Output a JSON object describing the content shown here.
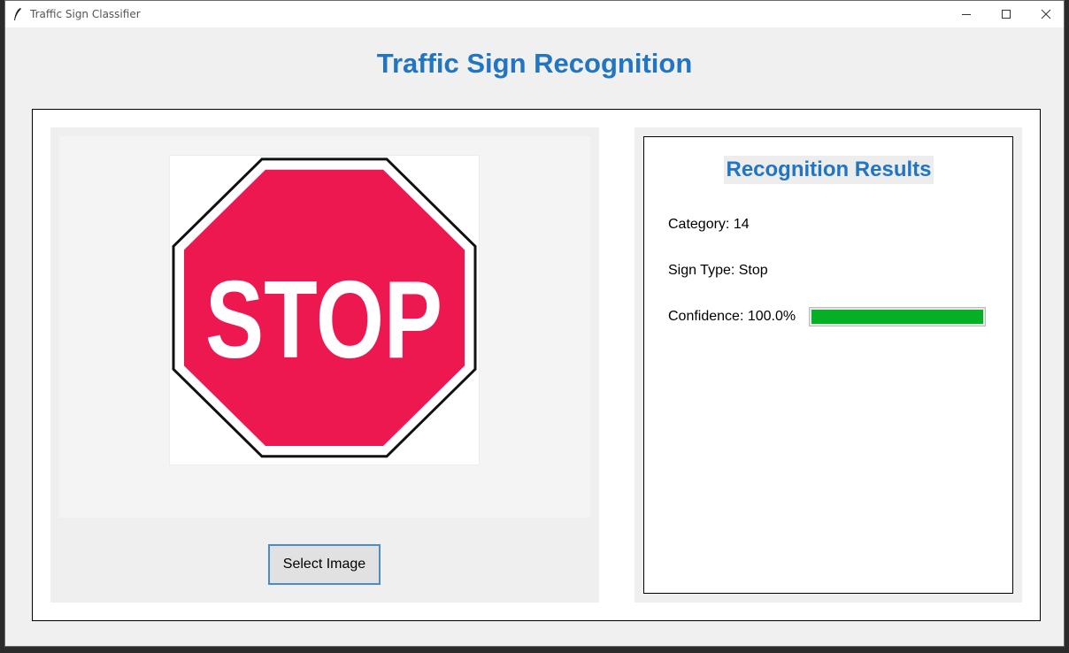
{
  "window": {
    "title": "Traffic Sign Classifier"
  },
  "header": {
    "title": "Traffic Sign Recognition"
  },
  "image_panel": {
    "image_icon": "stop-sign-icon",
    "image_text": "STOP",
    "select_button_label": "Select Image"
  },
  "results": {
    "title": "Recognition Results",
    "category_text": "Category: 14",
    "sign_type_text": "Sign Type: Stop",
    "confidence_text": "Confidence: 100.0%",
    "confidence_value": 1.0
  },
  "colors": {
    "title_blue": "#2175c1",
    "progress_green": "#06b025",
    "stop_red": "#ee1850",
    "button_border": "#4a8cc7"
  }
}
